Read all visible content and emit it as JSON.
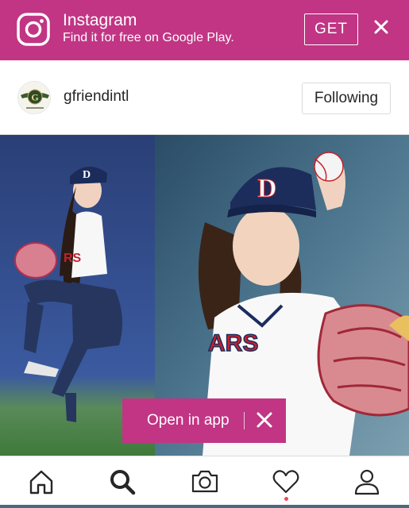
{
  "banner": {
    "app_name": "Instagram",
    "subtitle": "Find it for free on Google Play.",
    "get_label": "GET",
    "color": "#c13584",
    "logo_icon": "instagram-logo-icon",
    "close_icon": "close-icon"
  },
  "post": {
    "username": "gfriendintl",
    "follow_label": "Following",
    "avatar_letter": "G"
  },
  "photo": {
    "cap_letter": "D",
    "jersey_text_left": "RS",
    "jersey_text_right": "ARS"
  },
  "open_app": {
    "label": "Open in app",
    "close_icon": "close-icon"
  },
  "nav": {
    "items": [
      "home-icon",
      "search-icon",
      "camera-icon",
      "heart-icon",
      "profile-icon"
    ],
    "activity_dot_color": "#ed4956"
  }
}
